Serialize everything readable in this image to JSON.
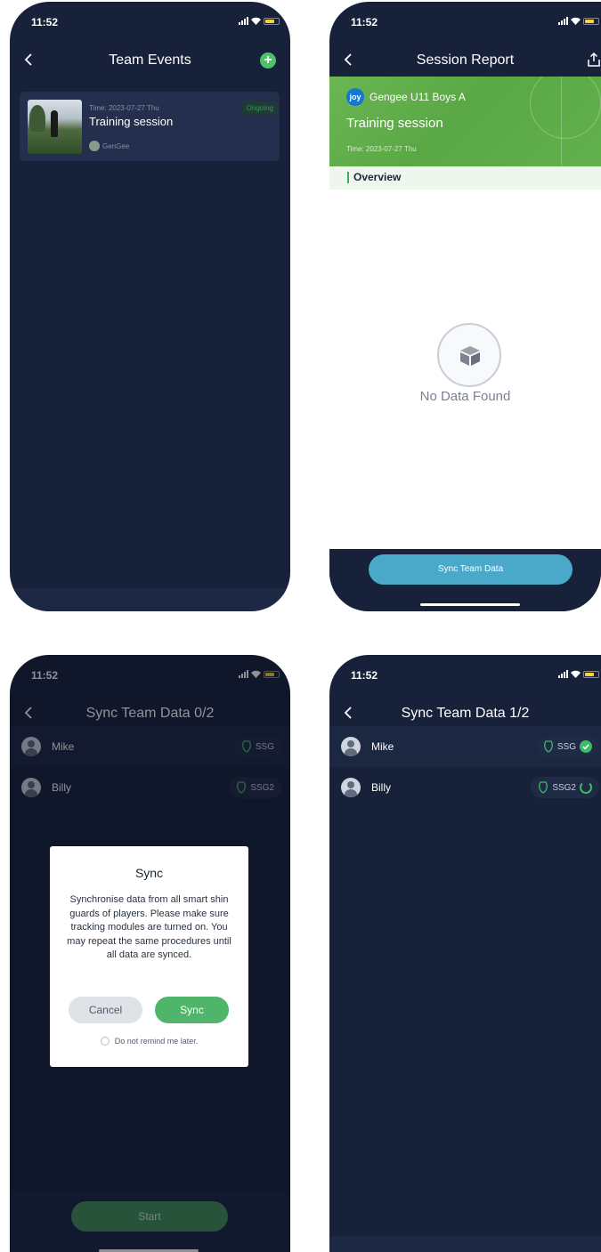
{
  "status": {
    "time": "11:52"
  },
  "screen1": {
    "title": "Team Events",
    "add_icon": "plus-icon",
    "event": {
      "time": "Time: 2023-07-27 Thu",
      "title": "Training session",
      "owner": "GenGee",
      "status": "Ongoing"
    }
  },
  "screen2": {
    "title": "Session Report",
    "share_icon": "share-icon",
    "team_logo": "joy",
    "team_name": "Gengee U11 Boys A",
    "session_title": "Training session",
    "session_time": "Time: 2023-07-27 Thu",
    "section": "Overview",
    "empty_text": "No Data Found",
    "sync_button": "Sync Team Data"
  },
  "screen3": {
    "title": "Sync Team Data 0/2",
    "players": [
      {
        "name": "Mike",
        "device": "SSG"
      },
      {
        "name": "Billy",
        "device": "SSG2"
      }
    ],
    "dialog": {
      "title": "Sync",
      "message": "Synchronise data from all smart shin guards of players. Please make sure tracking modules are turned on. You may repeat the same procedures until all data are synced.",
      "cancel": "Cancel",
      "confirm": "Sync",
      "remind": "Do not remind me later."
    },
    "start_button": "Start"
  },
  "screen4": {
    "title": "Sync Team Data 1/2",
    "players": [
      {
        "name": "Mike",
        "device": "SSG",
        "state": "synced"
      },
      {
        "name": "Billy",
        "device": "SSG2",
        "state": "syncing"
      }
    ]
  },
  "colors": {
    "bg": "#17213a",
    "accent": "#4fb56a",
    "sync_blue": "#4aa9c9"
  }
}
